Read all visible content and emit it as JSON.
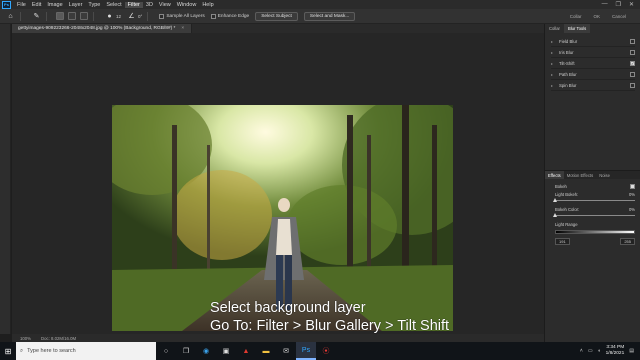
{
  "menubar": {
    "logo": "Ps",
    "items": [
      "File",
      "Edit",
      "Image",
      "Layer",
      "Type",
      "Select",
      "Filter",
      "3D",
      "View",
      "Window",
      "Help"
    ],
    "active_index": 6,
    "window_controls": [
      "—",
      "❐",
      "✕"
    ]
  },
  "options": {
    "brush_size": "12",
    "angle": "0°",
    "sample_all_layers": "Sample All Layers",
    "enhance_edge": "Enhance Edge",
    "select_subject": "Select Subject",
    "select_and_mask": "Select and Mask...",
    "right_labels": [
      "Collar",
      "OK",
      "Cancel"
    ]
  },
  "document": {
    "tab_title": "gettyimages-909223266-2048x2048.jpg @ 100% (Background, RGB/8#) *",
    "close": "×"
  },
  "statusbar": {
    "zoom": "100%",
    "doc": "Doc: 8.02M/16.0M"
  },
  "caption": {
    "line1": "Select background layer",
    "line2": "Go To: Filter > Blur Gallery > Tilt Shift"
  },
  "panel_top_tabs": [
    "Collar",
    "Blur Tools"
  ],
  "blur_tools": [
    {
      "label": "Field Blur",
      "checked": false
    },
    {
      "label": "Iris Blur",
      "checked": false
    },
    {
      "label": "Tilt-Shift",
      "checked": true
    },
    {
      "label": "Path Blur",
      "checked": false
    },
    {
      "label": "Spin Blur",
      "checked": false
    }
  ],
  "effects": {
    "tabs": [
      "Effects",
      "Motion Effects",
      "Noise"
    ],
    "bokeh_label": "Bokeh",
    "light_bokeh_label": "Light Bokeh:",
    "light_bokeh_value": "0%",
    "bokeh_color_label": "Bokeh Color:",
    "bokeh_color_value": "0%",
    "light_range_label": "Light Range",
    "range_low": "191",
    "range_high": "255"
  },
  "taskbar": {
    "search_placeholder": "Type here to search",
    "time": "3:34 PM",
    "date": "1/8/2021"
  },
  "colors": {
    "accent": "#31a8ff",
    "panel_bg": "#2c2c2c",
    "canvas_bg": "#262626"
  }
}
